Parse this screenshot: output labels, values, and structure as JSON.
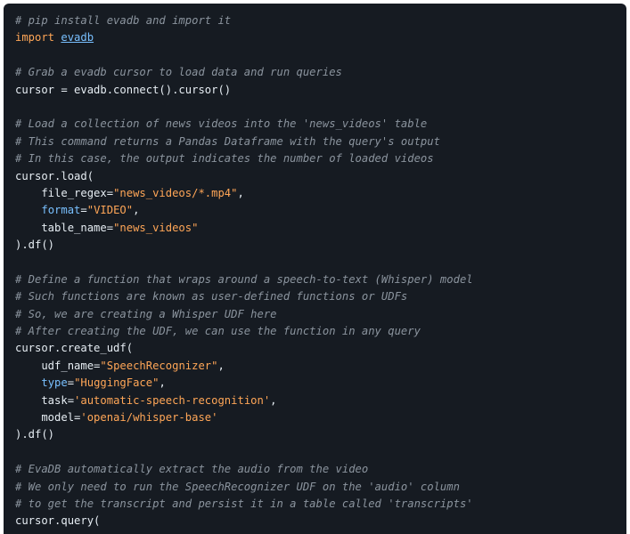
{
  "lines": [
    [
      {
        "t": "c",
        "v": "# pip install evadb and import it"
      }
    ],
    [
      {
        "t": "k",
        "v": "import"
      },
      {
        "t": "p",
        "v": " "
      },
      {
        "t": "m",
        "v": "evadb"
      }
    ],
    [],
    [
      {
        "t": "c",
        "v": "# Grab a evadb cursor to load data and run queries"
      }
    ],
    [
      {
        "t": "p",
        "v": "cursor = evadb.connect().cursor()"
      }
    ],
    [],
    [
      {
        "t": "c",
        "v": "# Load a collection of news videos into the 'news_videos' table"
      }
    ],
    [
      {
        "t": "c",
        "v": "# This command returns a Pandas Dataframe with the query's output"
      }
    ],
    [
      {
        "t": "c",
        "v": "# In this case, the output indicates the number of loaded videos"
      }
    ],
    [
      {
        "t": "p",
        "v": "cursor.load("
      }
    ],
    [
      {
        "t": "p",
        "v": "    file_regex="
      },
      {
        "t": "s",
        "v": "\"news_videos/*.mp4\""
      },
      {
        "t": "p",
        "v": ","
      }
    ],
    [
      {
        "t": "p",
        "v": "    "
      },
      {
        "t": "a",
        "v": "format"
      },
      {
        "t": "p",
        "v": "="
      },
      {
        "t": "s",
        "v": "\"VIDEO\""
      },
      {
        "t": "p",
        "v": ","
      }
    ],
    [
      {
        "t": "p",
        "v": "    table_name="
      },
      {
        "t": "s",
        "v": "\"news_videos\""
      }
    ],
    [
      {
        "t": "p",
        "v": ").df()"
      }
    ],
    [],
    [
      {
        "t": "c",
        "v": "# Define a function that wraps around a speech-to-text (Whisper) model"
      }
    ],
    [
      {
        "t": "c",
        "v": "# Such functions are known as user-defined functions or UDFs"
      }
    ],
    [
      {
        "t": "c",
        "v": "# So, we are creating a Whisper UDF here"
      }
    ],
    [
      {
        "t": "c",
        "v": "# After creating the UDF, we can use the function in any query"
      }
    ],
    [
      {
        "t": "p",
        "v": "cursor.create_udf("
      }
    ],
    [
      {
        "t": "p",
        "v": "    udf_name="
      },
      {
        "t": "s",
        "v": "\"SpeechRecognizer\""
      },
      {
        "t": "p",
        "v": ","
      }
    ],
    [
      {
        "t": "p",
        "v": "    "
      },
      {
        "t": "a",
        "v": "type"
      },
      {
        "t": "p",
        "v": "="
      },
      {
        "t": "s",
        "v": "\"HuggingFace\""
      },
      {
        "t": "p",
        "v": ","
      }
    ],
    [
      {
        "t": "p",
        "v": "    task="
      },
      {
        "t": "s",
        "v": "'automatic-speech-recognition'"
      },
      {
        "t": "p",
        "v": ","
      }
    ],
    [
      {
        "t": "p",
        "v": "    model="
      },
      {
        "t": "s",
        "v": "'openai/whisper-base'"
      }
    ],
    [
      {
        "t": "p",
        "v": ").df()"
      }
    ],
    [],
    [
      {
        "t": "c",
        "v": "# EvaDB automatically extract the audio from the video"
      }
    ],
    [
      {
        "t": "c",
        "v": "# We only need to run the SpeechRecognizer UDF on the 'audio' column"
      }
    ],
    [
      {
        "t": "c",
        "v": "# to get the transcript and persist it in a table called 'transcripts'"
      }
    ],
    [
      {
        "t": "p",
        "v": "cursor.query("
      }
    ]
  ]
}
